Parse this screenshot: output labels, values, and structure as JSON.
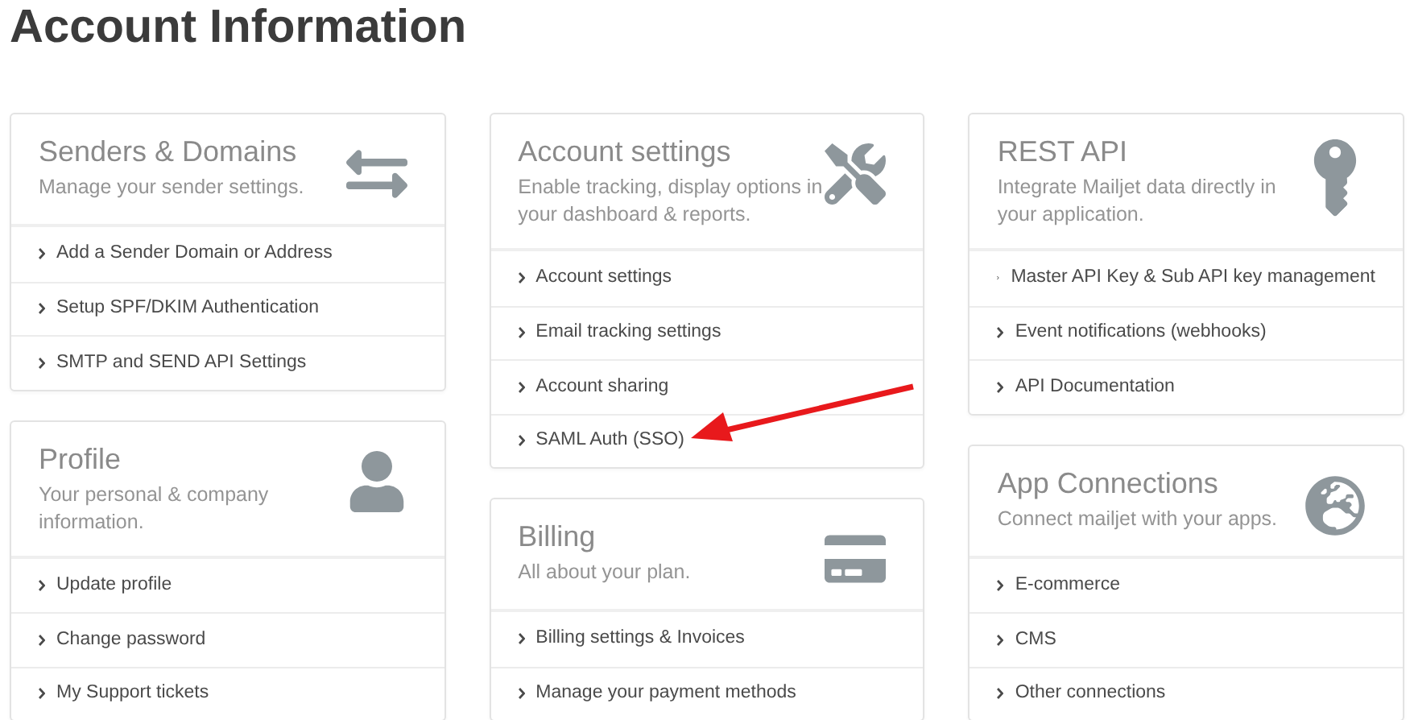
{
  "page_title": "Account Information",
  "columns": [
    {
      "cards": [
        {
          "title": "Senders & Domains",
          "description": "Manage your sender settings.",
          "links": [
            {
              "label": "Add a Sender Domain or Address",
              "annotated": false
            },
            {
              "label": "Setup SPF/DKIM Authentication",
              "annotated": false
            },
            {
              "label": "SMTP and SEND API Settings",
              "annotated": false
            }
          ]
        },
        {
          "title": "Profile",
          "description": "Your personal & company information.",
          "links": [
            {
              "label": "Update profile",
              "annotated": false
            },
            {
              "label": "Change password",
              "annotated": false
            },
            {
              "label": "My Support tickets",
              "annotated": false
            }
          ]
        }
      ]
    },
    {
      "cards": [
        {
          "title": "Account settings",
          "description": "Enable tracking, display options in your dashboard & reports.",
          "links": [
            {
              "label": "Account settings",
              "annotated": false
            },
            {
              "label": "Email tracking settings",
              "annotated": false
            },
            {
              "label": "Account sharing",
              "annotated": false
            },
            {
              "label": "SAML Auth (SSO)",
              "annotated": true
            }
          ]
        },
        {
          "title": "Billing",
          "description": "All about your plan.",
          "links": [
            {
              "label": "Billing settings & Invoices",
              "annotated": false
            },
            {
              "label": "Manage your payment methods",
              "annotated": false
            }
          ]
        }
      ]
    },
    {
      "cards": [
        {
          "title": "REST API",
          "description": "Integrate Mailjet data directly in your application.",
          "links": [
            {
              "label": "Master API Key & Sub API key management",
              "annotated": false
            },
            {
              "label": "Event notifications (webhooks)",
              "annotated": false
            },
            {
              "label": "API Documentation",
              "annotated": false
            }
          ]
        },
        {
          "title": "App Connections",
          "description": "Connect mailjet with your apps.",
          "links": [
            {
              "label": "E-commerce",
              "annotated": false
            },
            {
              "label": "CMS",
              "annotated": false
            },
            {
              "label": "Other connections",
              "annotated": false
            }
          ]
        }
      ]
    }
  ]
}
